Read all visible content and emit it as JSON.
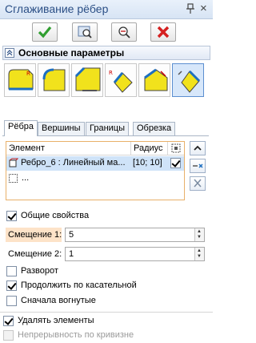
{
  "window": {
    "title": "Сглаживание рёбер"
  },
  "section": {
    "title": "Основные параметры"
  },
  "tabs": [
    "Рёбра",
    "Вершины",
    "Границы",
    "Обрезка"
  ],
  "list": {
    "col_element": "Элемент",
    "col_radius": "Радиус",
    "rows": [
      {
        "element": "Ребро_6 : Линейный ма...",
        "radius": "[10; 10]",
        "checked": true
      },
      {
        "element": "..."
      }
    ]
  },
  "options": {
    "general_props": {
      "label": "Общие свойства",
      "checked": true
    },
    "offset1": {
      "label": "Смещение 1:",
      "value": "5"
    },
    "offset2": {
      "label": "Смещение 2:",
      "value": "1"
    },
    "reversal": {
      "label": "Разворот",
      "checked": false
    },
    "tangent": {
      "label": "Продолжить по касательной",
      "checked": true
    },
    "concave_first": {
      "label": "Сначала вогнутые",
      "checked": false
    },
    "delete_elements": {
      "label": "Удалять элементы",
      "checked": true
    },
    "curvature_continuity": {
      "label": "Непрерывность по кривизне",
      "checked": false
    }
  },
  "colors": {
    "ok_green": "#2f9e2f",
    "cancel_red": "#d52020",
    "selection_blue": "#cfe3f8",
    "highlight_orange": "#fde3c8"
  }
}
